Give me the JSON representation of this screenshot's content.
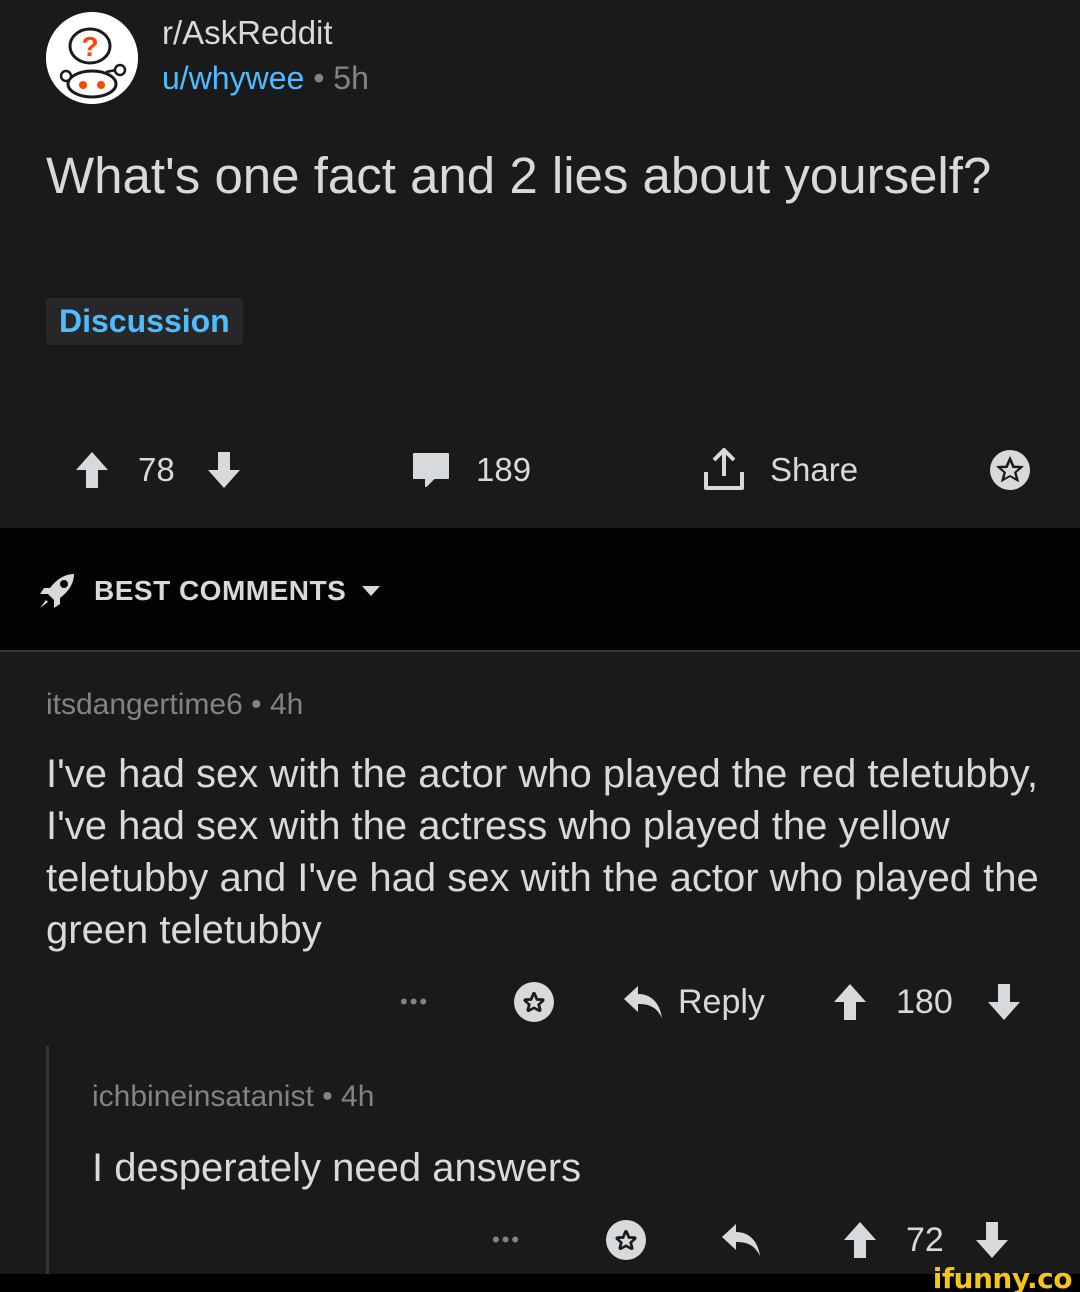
{
  "post": {
    "subreddit": "r/AskReddit",
    "author": "u/whywee",
    "separator": "•",
    "age": "5h",
    "title": "What's one fact and 2 lies about yourself?",
    "flair": "Discussion",
    "score": "78",
    "comment_count": "189",
    "share_label": "Share"
  },
  "sort": {
    "label": "BEST COMMENTS"
  },
  "comments": [
    {
      "author": "itsdangertime6",
      "separator": "•",
      "age": "4h",
      "body": "I've had sex with the actor who played the red teletubby, I've had sex with the actress who played the yellow teletubby and I've had sex with the actor who played the green teletubby",
      "more": "•••",
      "reply_label": "Reply",
      "score": "180"
    },
    {
      "author": "ichbineinsatanist",
      "separator": "•",
      "age": "4h",
      "body": "I desperately need answers",
      "more": "•••",
      "score": "72"
    }
  ],
  "watermark": "ifunny.co",
  "colors": {
    "background": "#1a1a1b",
    "sort_bar": "#030303",
    "link_blue": "#4fbcff",
    "muted": "#818384",
    "text": "#d7dadc",
    "watermark": "#f5c518"
  }
}
